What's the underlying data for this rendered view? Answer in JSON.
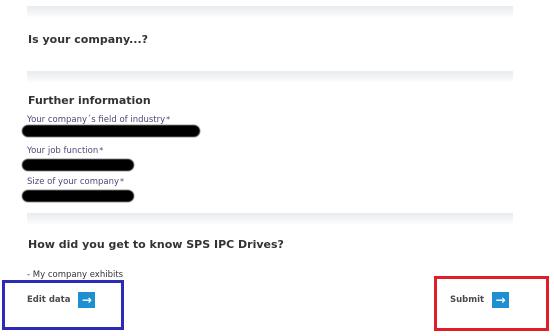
{
  "sections": {
    "company": {
      "title": "Is your company...?"
    },
    "further": {
      "title": "Further information",
      "fields": [
        {
          "label": "Your company´s field of industry",
          "required_mark": "*"
        },
        {
          "label": "Your job function",
          "required_mark": "*"
        },
        {
          "label": "Size of your company",
          "required_mark": "*"
        }
      ]
    },
    "source": {
      "title": "How did you get to know SPS IPC Drives?",
      "answer": "- My company exhibits"
    }
  },
  "actions": {
    "edit_label": "Edit data",
    "submit_label": "Submit"
  },
  "colors": {
    "arrow_button": "#1e8fd1",
    "edit_highlight": "#2b2bb8",
    "submit_highlight": "#e01e2a"
  }
}
